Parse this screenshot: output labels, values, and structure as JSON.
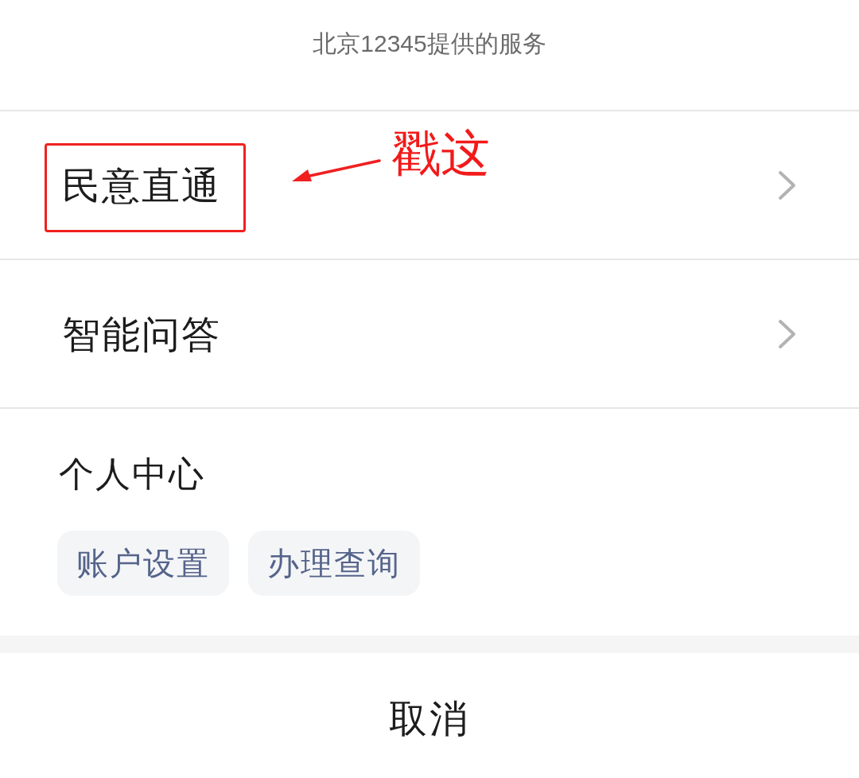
{
  "header": {
    "title": "北京12345提供的服务"
  },
  "menu_items": [
    {
      "label": "民意直通",
      "highlighted": true
    },
    {
      "label": "智能问答",
      "highlighted": false
    }
  ],
  "personal_center": {
    "title": "个人中心",
    "chips": [
      "账户设置",
      "办理查询"
    ]
  },
  "annotation": {
    "label": "戳这"
  },
  "cancel_button": {
    "label": "取消"
  }
}
